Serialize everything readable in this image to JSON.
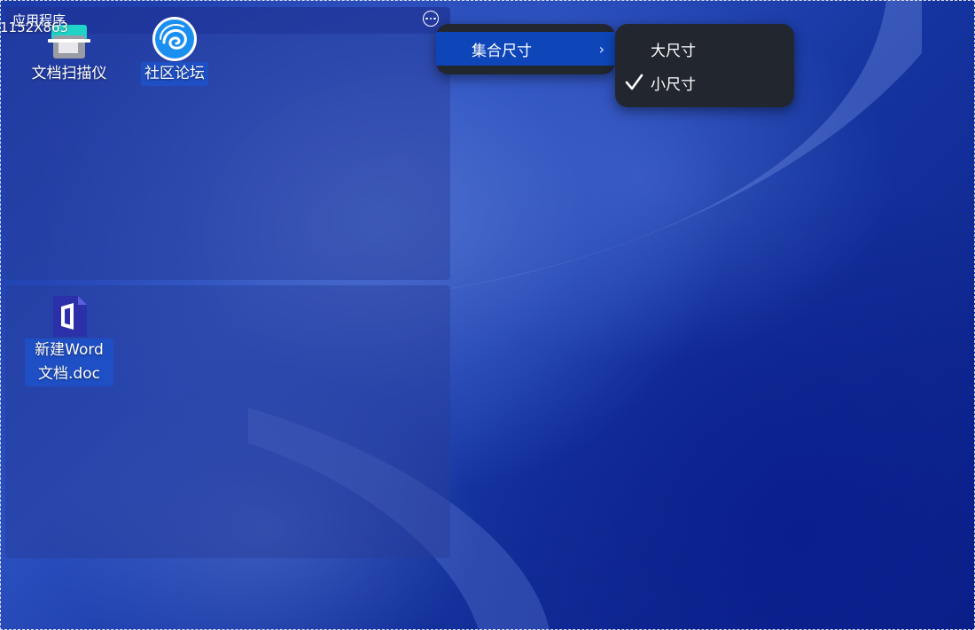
{
  "desktop": {
    "resolution_label": "1152X863"
  },
  "collection_top": {
    "title": "应用程序",
    "more_icon": "more-horizontal-icon",
    "items": [
      {
        "label": "文档扫描仪",
        "icon": "scanner-icon",
        "selected": false
      },
      {
        "label": "社区论坛",
        "icon": "deepin-forum-icon",
        "selected": true
      }
    ]
  },
  "collection_bottom": {
    "items": [
      {
        "label": "新建Word文档.doc",
        "icon": "word-document-icon",
        "selected": true
      }
    ]
  },
  "context_menu": {
    "item_label": "集合尺寸",
    "arrow": "›",
    "submenu": [
      {
        "label": "大尺寸",
        "checked": false
      },
      {
        "label": "小尺寸",
        "checked": true
      }
    ]
  },
  "colors": {
    "menu_bg": "#22262f",
    "menu_highlight": "#0e46ba",
    "selection_highlight": "#1e4fc4"
  }
}
